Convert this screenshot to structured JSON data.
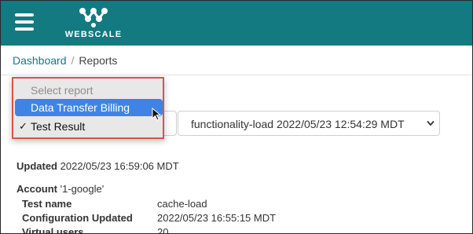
{
  "header": {
    "brand": "WEBSCALE",
    "menu_icon": "hamburger-menu-icon",
    "logo_icon": "webscale-logo-icon",
    "background_color": "#127a80"
  },
  "breadcrumb": {
    "link": "Dashboard",
    "separator": "/",
    "current": "Reports"
  },
  "report_dropdown": {
    "placeholder": "Select report",
    "options": [
      {
        "label": "Data Transfer Billing",
        "highlighted": true
      },
      {
        "label": "Test Result",
        "checked": true
      }
    ],
    "highlight_color": "#3f84e5",
    "annotation_color": "#d9534f"
  },
  "run_select": {
    "value": "functionality-load 2022/05/23 12:54:29 MDT",
    "icon": "chevron-down-icon"
  },
  "details": {
    "updated_label": "Updated",
    "updated_value": "2022/05/23 16:59:06 MDT",
    "account_label": "Account",
    "account_value": "'1-google'",
    "rows": [
      {
        "key": "Test name",
        "value": "cache-load"
      },
      {
        "key": "Configuration Updated",
        "value": "2022/05/23 16:55:15 MDT"
      },
      {
        "key": "Virtual users",
        "value": "20"
      }
    ]
  }
}
